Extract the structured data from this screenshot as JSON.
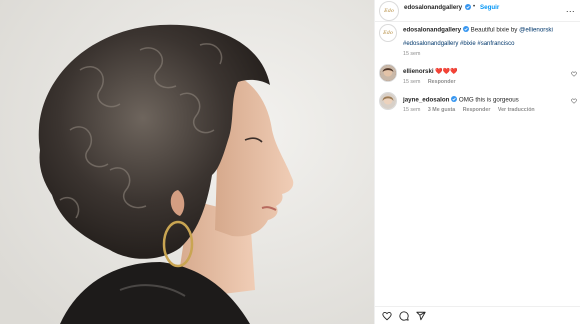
{
  "post": {
    "username": "edosalonandgallery",
    "follow_label": "Seguir",
    "separator": "•",
    "more_label": "...",
    "avatar_text": "Edo"
  },
  "caption": {
    "username": "edosalonandgallery",
    "text": "Beautiful bixie by ",
    "mention": "@ellienorski",
    "hashtags": "#edosalonandgallery #bixie #sanfrancisco",
    "time": "15 sem"
  },
  "comments": [
    {
      "username": "ellienorski",
      "text": "❤️❤️❤️",
      "time": "15 sem",
      "reply": "Responder"
    },
    {
      "username": "jayne_edosalon",
      "text": "OMG this is gorgeous",
      "time": "15 sem",
      "likes": "3 Me gusta",
      "reply": "Responder",
      "translate": "Ver traducción"
    }
  ],
  "icons": [
    "verified-icon",
    "more-icon",
    "heart-icon",
    "comment-icon",
    "share-icon"
  ],
  "colors": {
    "accent": "#0095f6",
    "link": "#00376b",
    "muted": "#8e8e8e",
    "verified": "#3897f0"
  }
}
